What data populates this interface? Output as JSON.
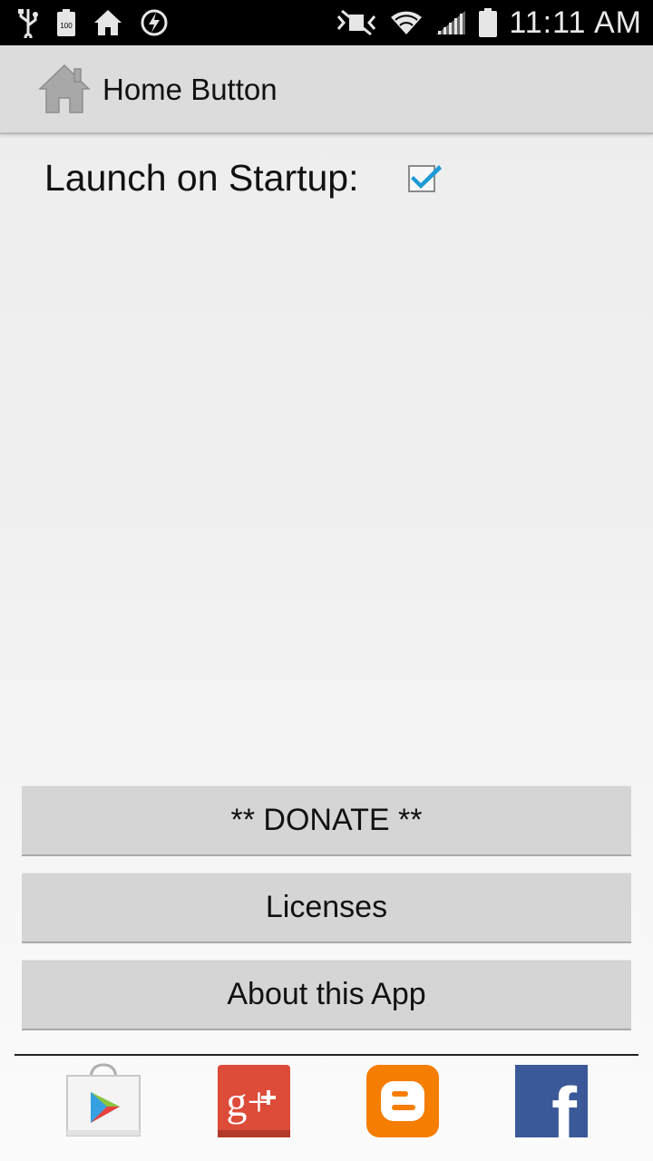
{
  "status_bar": {
    "time": "11:11 AM",
    "left_icons": [
      "usb-icon",
      "battery-100-icon",
      "home-icon",
      "flash-icon"
    ],
    "right_icons": [
      "mute-icon",
      "wifi-icon",
      "signal-icon",
      "battery-icon"
    ]
  },
  "action_bar": {
    "title": "Home Button",
    "icon": "home-icon"
  },
  "settings": {
    "launch_on_startup_label": "Launch on Startup:",
    "launch_on_startup_checked": true
  },
  "buttons": {
    "donate": "** DONATE **",
    "licenses": "Licenses",
    "about": "About this App"
  },
  "social_links": [
    {
      "name": "google-play",
      "icon": "play-store-icon"
    },
    {
      "name": "google-plus",
      "icon": "google-plus-icon",
      "text": "g+"
    },
    {
      "name": "blogger",
      "icon": "blogger-icon"
    },
    {
      "name": "facebook",
      "icon": "facebook-icon",
      "text": "f"
    }
  ],
  "colors": {
    "checkbox_accent": "#1e9ad6",
    "google_plus": "#dd4b39",
    "blogger": "#f57d00",
    "facebook": "#3b5998"
  }
}
